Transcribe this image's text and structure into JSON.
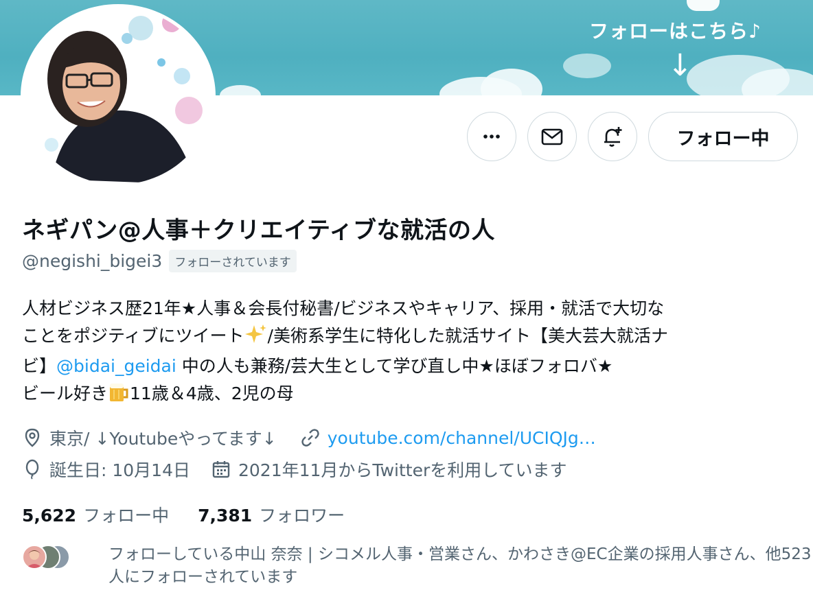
{
  "banner": {
    "caption": "フォローはこちら♪",
    "arrow": "↓"
  },
  "actions": {
    "more_icon": "more-icon",
    "message_icon": "envelope-icon",
    "notify_icon": "bell-plus-icon",
    "follow_label": "フォロー中"
  },
  "profile": {
    "display_name": "ネギパン@人事＋クリエイティブな就活の人",
    "handle": "@negishi_bigei3",
    "follows_you": "フォローされています"
  },
  "bio": {
    "line1": "人材ビジネス歴21年★人事＆会長付秘書/ビジネスやキャリア、採用・就活で大切な",
    "line2_a": "ことをポジティブにツイート",
    "line2_b": "/美術系学生に特化した就活サイト【美大芸大就活ナ",
    "line3_a": "ビ】",
    "line3_link": "@bidai_geidai",
    "line3_b": " 中の人も兼務/芸大生として学び直し中★ほぼフォロバ★",
    "line4_a": "ビール好き",
    "line4_b": "11歳＆4歳、2児の母"
  },
  "meta": {
    "location": "東京/ ↓Youtubeやってます↓",
    "url": "youtube.com/channel/UCIQJg…",
    "birthday": "誕生日: 10月14日",
    "joined": "2021年11月からTwitterを利用しています"
  },
  "stats": {
    "following_count": "5,622",
    "following_label": "フォロー中",
    "followers_count": "7,381",
    "followers_label": "フォロワー"
  },
  "known_followers": {
    "text": "フォローしている中山 奈奈 | シコメル人事・営業さん、かわさき@EC企業の採用人事さん、他523人にフォローされています"
  },
  "colors": {
    "accent": "#1d9bf0",
    "secondary_text": "#536471",
    "banner": "#4fb0c0"
  }
}
